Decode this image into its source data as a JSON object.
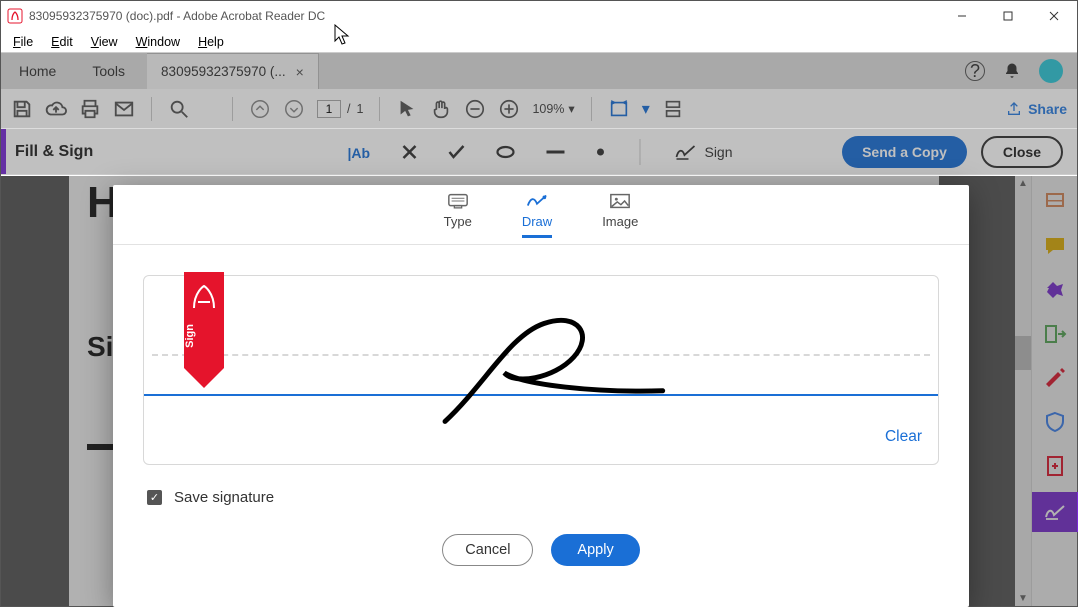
{
  "window": {
    "title": "83095932375970 (doc).pdf - Adobe Acrobat Reader DC"
  },
  "menu": {
    "file": "File",
    "edit": "Edit",
    "view": "View",
    "window": "Window",
    "help": "Help"
  },
  "tabs": {
    "home": "Home",
    "tools": "Tools",
    "doc": "83095932375970 (..."
  },
  "maintoolbar": {
    "page_current": "1",
    "page_sep": "/",
    "page_total": "1",
    "zoom": "109%",
    "share": "Share"
  },
  "fillSignBar": {
    "title": "Fill & Sign",
    "sign": "Sign",
    "send": "Send a Copy",
    "close": "Close"
  },
  "document": {
    "heading_fragment": "H",
    "section_fragment": "Sig"
  },
  "modal": {
    "tab_type": "Type",
    "tab_draw": "Draw",
    "tab_image": "Image",
    "bookmark": "Sign",
    "clear": "Clear",
    "save_signature": "Save signature",
    "cancel": "Cancel",
    "apply": "Apply"
  }
}
